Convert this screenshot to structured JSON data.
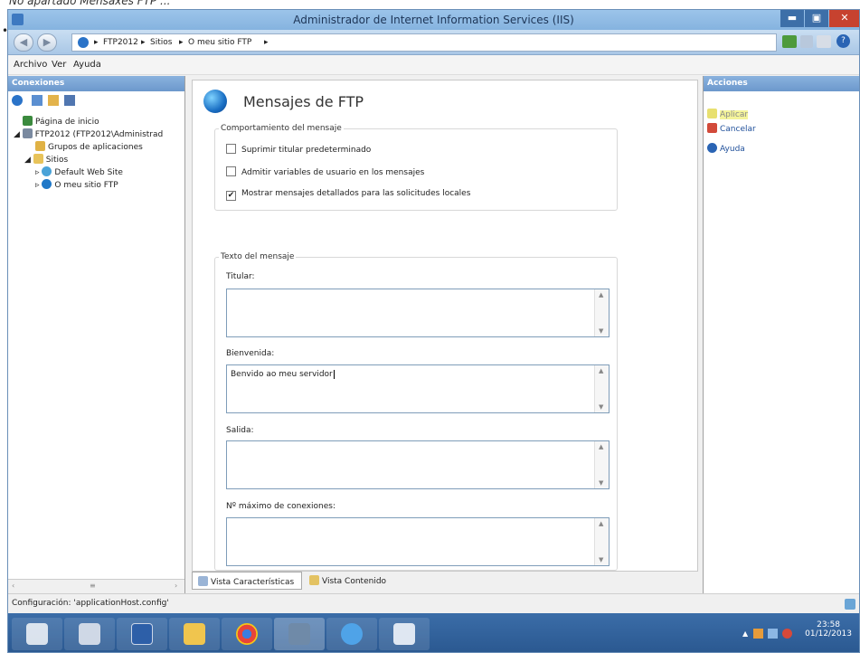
{
  "caption": "No apartado Mensaxes FTP ...",
  "window": {
    "title": "Administrador de Internet Information Services (IIS)"
  },
  "address": {
    "crumbs": [
      "FTP2012",
      "Sitios",
      "O meu sitio FTP"
    ]
  },
  "menu": [
    "Archivo",
    "Ver",
    "Ayuda"
  ],
  "connections": {
    "header": "Conexiones",
    "tree": [
      {
        "label": "Página de inicio",
        "level": 1,
        "icon": "home-icon"
      },
      {
        "label": "FTP2012 (FTP2012\\Administrad",
        "level": 1,
        "icon": "server-icon"
      },
      {
        "label": "Grupos de aplicaciones",
        "level": 2,
        "icon": "app-pool-icon"
      },
      {
        "label": "Sitios",
        "level": 2,
        "icon": "folder-icon"
      },
      {
        "label": "Default Web Site",
        "level": 3,
        "icon": "website-icon"
      },
      {
        "label": "O meu sitio FTP",
        "level": 3,
        "icon": "globe-icon"
      }
    ]
  },
  "page": {
    "title": "Mensajes de FTP",
    "behavior": {
      "legend": "Comportamiento del mensaje",
      "suppress": "Suprimir titular predeterminado",
      "variables": "Admitir variables de usuario en los mensajes",
      "detailed": "Mostrar mensajes detallados para las solicitudes locales"
    },
    "text": {
      "legend": "Texto del mensaje",
      "banner_label": "Titular:",
      "banner_value": "",
      "welcome_label": "Bienvenida:",
      "welcome_value": "Benvido ao meu servidor",
      "exit_label": "Salida:",
      "exit_value": "",
      "max_label": "Nº máximo de conexiones:",
      "max_value": ""
    }
  },
  "tabs": {
    "features": "Vista Características",
    "content": "Vista Contenido"
  },
  "actions": {
    "header": "Acciones",
    "apply": "Aplicar",
    "cancel": "Cancelar",
    "help": "Ayuda"
  },
  "status": "Configuración: 'applicationHost.config'",
  "clock": {
    "time": "23:58",
    "date": "01/12/2013"
  }
}
